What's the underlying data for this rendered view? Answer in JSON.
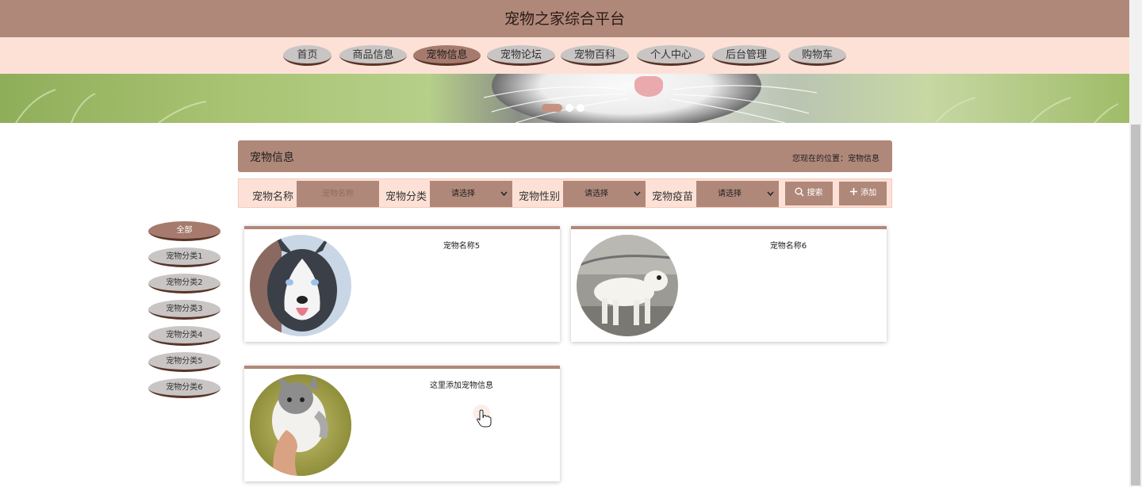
{
  "app": {
    "title": "宠物之家综合平台"
  },
  "nav": {
    "items": [
      {
        "label": "首页"
      },
      {
        "label": "商品信息"
      },
      {
        "label": "宠物信息",
        "active": true
      },
      {
        "label": "宠物论坛"
      },
      {
        "label": "宠物百科"
      },
      {
        "label": "个人中心"
      },
      {
        "label": "后台管理"
      },
      {
        "label": "购物车"
      }
    ]
  },
  "carousel": {
    "slides": 3,
    "active_index": 0
  },
  "panel": {
    "title": "宠物信息",
    "location": "您现在的位置：宠物信息"
  },
  "search": {
    "name_label": "宠物名称",
    "name_placeholder": "宠物名称",
    "category_label": "宠物分类",
    "category_value": "请选择",
    "gender_label": "宠物性别",
    "gender_value": "请选择",
    "vaccine_label": "宠物疫苗",
    "vaccine_value": "请选择",
    "search_button": "搜索",
    "add_button": "添加"
  },
  "categories": [
    "全部",
    "宠物分类1",
    "宠物分类2",
    "宠物分类3",
    "宠物分类4",
    "宠物分类5",
    "宠物分类6"
  ],
  "pets": [
    {
      "name": "宠物名称5",
      "image": "husky"
    },
    {
      "name": "宠物名称6",
      "image": "bull-terrier"
    },
    {
      "name": "这里添加宠物信息",
      "image": "cat"
    }
  ],
  "colors": {
    "brand": "#b0887a",
    "nav_bg": "#fde1d6",
    "pill": "#c8c5c4",
    "pill_border": "#5a3328"
  }
}
